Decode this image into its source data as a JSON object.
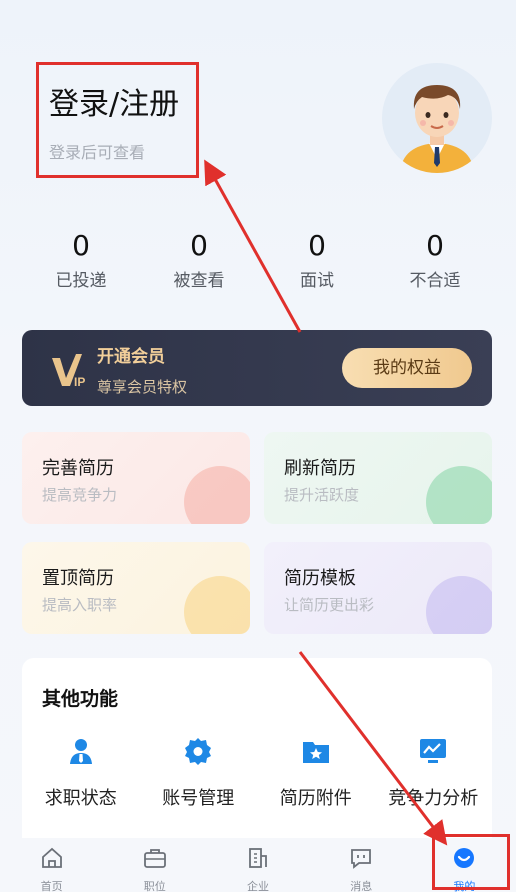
{
  "header": {
    "login_title": "登录/注册",
    "login_sub": "登录后可查看"
  },
  "stats": [
    {
      "value": "0",
      "label": "已投递"
    },
    {
      "value": "0",
      "label": "被查看"
    },
    {
      "value": "0",
      "label": "面试"
    },
    {
      "value": "0",
      "label": "不合适"
    }
  ],
  "vip": {
    "title": "开通会员",
    "subtitle": "尊享会员特权",
    "button": "我的权益"
  },
  "cards": [
    {
      "title": "完善简历",
      "subtitle": "提高竞争力"
    },
    {
      "title": "刷新简历",
      "subtitle": "提升活跃度"
    },
    {
      "title": "置顶简历",
      "subtitle": "提高入职率"
    },
    {
      "title": "简历模板",
      "subtitle": "让简历更出彩"
    }
  ],
  "other": {
    "title": "其他功能",
    "items": [
      {
        "label": "求职状态",
        "icon": "job-status-icon"
      },
      {
        "label": "账号管理",
        "icon": "gear-icon"
      },
      {
        "label": "简历附件",
        "icon": "attachment-folder-icon"
      },
      {
        "label": "竞争力分析",
        "icon": "analysis-chart-icon"
      }
    ]
  },
  "tabbar": {
    "items": [
      {
        "label": "首页",
        "icon": "home-icon"
      },
      {
        "label": "职位",
        "icon": "briefcase-icon"
      },
      {
        "label": "企业",
        "icon": "building-icon"
      },
      {
        "label": "消息",
        "icon": "message-icon"
      },
      {
        "label": "我的",
        "icon": "mine-icon"
      }
    ],
    "active_color": "#1677ff"
  },
  "colors": {
    "accent": "#1677ff",
    "highlight_red": "#e0302c",
    "vip_gold": "#f2cf9a"
  }
}
